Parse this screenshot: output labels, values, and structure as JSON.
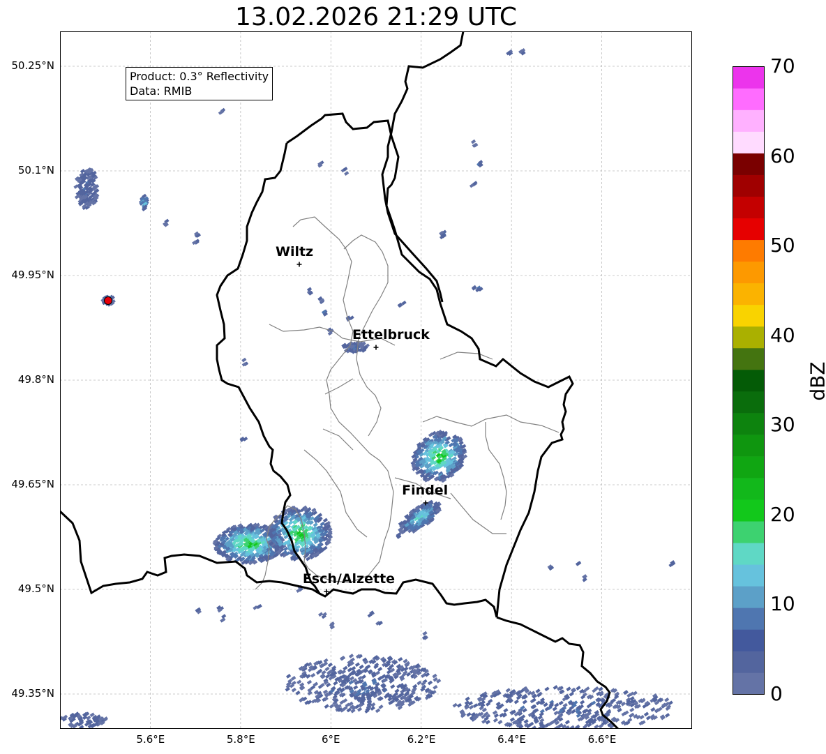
{
  "title": "13.02.2026 21:29 UTC",
  "info_box": {
    "product": "Product: 0.3° Reflectivity",
    "data_source": "Data: RMIB"
  },
  "map": {
    "lon_range": [
      5.4,
      6.8
    ],
    "lat_range": [
      49.3,
      50.3
    ],
    "lon_ticks": [
      "5.6°E",
      "5.8°E",
      "6°E",
      "6.2°E",
      "6.4°E",
      "6.6°E"
    ],
    "lat_ticks": [
      "50.25°N",
      "50.1°N",
      "49.95°N",
      "49.8°N",
      "49.65°N",
      "49.5°N",
      "49.35°N"
    ],
    "grid": true,
    "cities": [
      {
        "name": "Wiltz",
        "lon": 5.93,
        "lat": 49.966
      },
      {
        "name": "Ettelbruck",
        "lon": 6.1,
        "lat": 49.847
      },
      {
        "name": "Findel",
        "lon": 6.21,
        "lat": 49.624
      },
      {
        "name": "Esch/Alzette",
        "lon": 5.99,
        "lat": 49.497
      }
    ],
    "radar_site_color": "#e8000b"
  },
  "colorbar": {
    "label": "dBZ",
    "ticks": [
      "0",
      "10",
      "20",
      "30",
      "40",
      "50",
      "60",
      "70"
    ],
    "colors": [
      "#6473a6",
      "#53659e",
      "#43599d",
      "#4f76b0",
      "#5ca0c8",
      "#66c2dd",
      "#5fd8c5",
      "#3dd270",
      "#12c81b",
      "#12b81b",
      "#10a612",
      "#0f960f",
      "#0d830e",
      "#0a6d0c",
      "#045b06",
      "#447410",
      "#aab000",
      "#f9d300",
      "#fbb300",
      "#fd9900",
      "#fe7b00",
      "#e60000",
      "#c40000",
      "#a00000",
      "#7a0000",
      "#ffdbff",
      "#ffb1ff",
      "#ff6cff",
      "#ec34ec"
    ]
  }
}
